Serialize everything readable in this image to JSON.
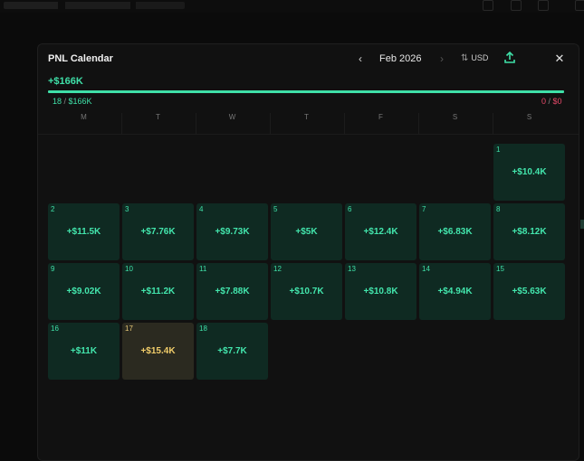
{
  "modal": {
    "title": "PNL Calendar",
    "month": "Feb 2026",
    "prev_icon": "chevron-left-icon",
    "next_icon": "chevron-right-icon",
    "currency": "USD",
    "currency_icon": "sort-arrows-icon",
    "export_icon": "export-icon",
    "close_icon": "close-icon",
    "close_glyph": "✕",
    "prev_glyph": "‹",
    "next_glyph": "›"
  },
  "summary": {
    "total": "+$166K",
    "wins_count": "18",
    "wins_sep": " / ",
    "wins_total": "$166K",
    "losses_count": "0",
    "losses_sep": " / ",
    "losses_total": "$0",
    "progress_fraction": 1.0
  },
  "weekdays": [
    "M",
    "T",
    "W",
    "T",
    "F",
    "S",
    "S"
  ],
  "days": [
    {
      "day": "1",
      "pnl": "+$10.4K",
      "col": 6,
      "row": 0,
      "today": false
    },
    {
      "day": "2",
      "pnl": "+$11.5K",
      "col": 0,
      "row": 1,
      "today": false
    },
    {
      "day": "3",
      "pnl": "+$7.76K",
      "col": 1,
      "row": 1,
      "today": false
    },
    {
      "day": "4",
      "pnl": "+$9.73K",
      "col": 2,
      "row": 1,
      "today": false
    },
    {
      "day": "5",
      "pnl": "+$5K",
      "col": 3,
      "row": 1,
      "today": false
    },
    {
      "day": "6",
      "pnl": "+$12.4K",
      "col": 4,
      "row": 1,
      "today": false
    },
    {
      "day": "7",
      "pnl": "+$6.83K",
      "col": 5,
      "row": 1,
      "today": false
    },
    {
      "day": "8",
      "pnl": "+$8.12K",
      "col": 6,
      "row": 1,
      "today": false
    },
    {
      "day": "9",
      "pnl": "+$9.02K",
      "col": 0,
      "row": 2,
      "today": false
    },
    {
      "day": "10",
      "pnl": "+$11.2K",
      "col": 1,
      "row": 2,
      "today": false
    },
    {
      "day": "11",
      "pnl": "+$7.88K",
      "col": 2,
      "row": 2,
      "today": false
    },
    {
      "day": "12",
      "pnl": "+$10.7K",
      "col": 3,
      "row": 2,
      "today": false
    },
    {
      "day": "13",
      "pnl": "+$10.8K",
      "col": 4,
      "row": 2,
      "today": false
    },
    {
      "day": "14",
      "pnl": "+$4.94K",
      "col": 5,
      "row": 2,
      "today": false
    },
    {
      "day": "15",
      "pnl": "+$5.63K",
      "col": 6,
      "row": 2,
      "today": false
    },
    {
      "day": "16",
      "pnl": "+$11K",
      "col": 0,
      "row": 3,
      "today": false
    },
    {
      "day": "17",
      "pnl": "+$15.4K",
      "col": 1,
      "row": 3,
      "today": true
    },
    {
      "day": "18",
      "pnl": "+$7.7K",
      "col": 2,
      "row": 3,
      "today": false
    }
  ],
  "colors": {
    "profit": "#3fe0a8",
    "loss": "#e94a6a",
    "today_text": "#f1cd6a"
  }
}
